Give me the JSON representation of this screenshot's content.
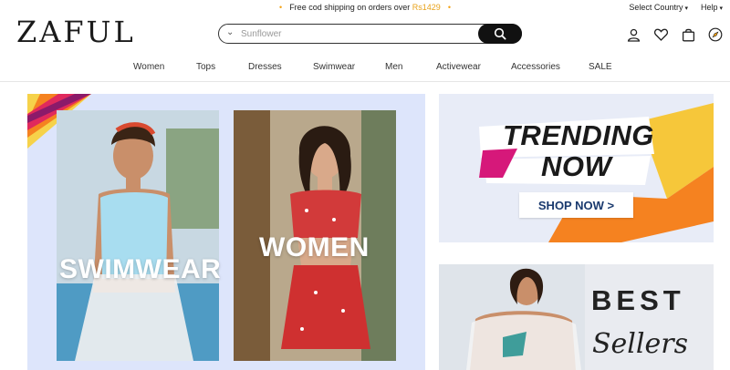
{
  "promo": {
    "dot_left": "•",
    "text": "Free cod shipping on orders over",
    "amount": "Rs1429",
    "dot_right": "•"
  },
  "topbar": {
    "country": "Select Country",
    "help": "Help"
  },
  "header": {
    "logo": "ZAFUL",
    "search_placeholder": "Sunflower"
  },
  "icons": [
    "user-icon",
    "heart-icon",
    "bag-icon",
    "compass-icon"
  ],
  "nav": {
    "items": [
      "Women",
      "Tops",
      "Dresses",
      "Swimwear",
      "Men",
      "Activewear",
      "Accessories",
      "SALE"
    ]
  },
  "banners": {
    "left": {
      "swimwear_label": "SWIMWEAR",
      "women_label": "WOMEN"
    },
    "trending": {
      "line1": "TRENDING",
      "line2": "NOW",
      "shop_label": "SHOP NOW >"
    },
    "bestsellers": {
      "line1": "BEST",
      "line2": "Sellers"
    }
  },
  "colors": {
    "accent_yellow": "#f4a316",
    "trend_orange": "#f58220",
    "trend_magenta": "#d6187a",
    "left_bg": "#dde5fb"
  }
}
